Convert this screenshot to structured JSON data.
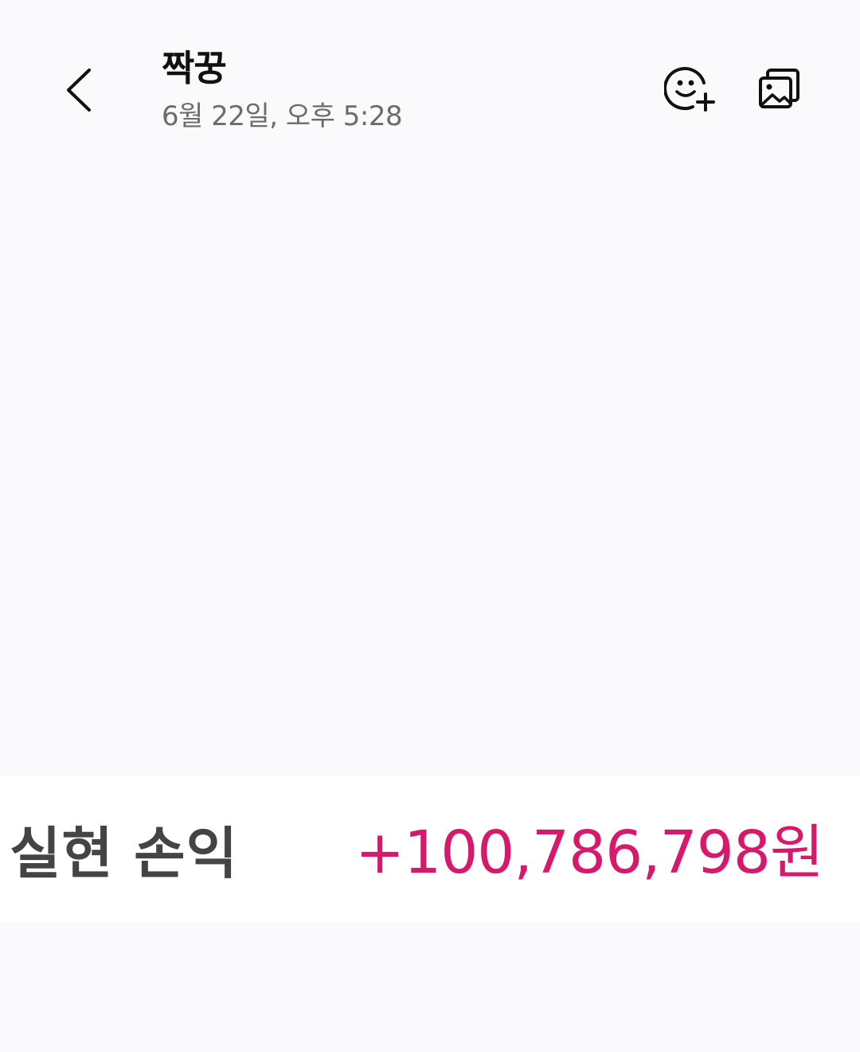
{
  "header": {
    "sender_name": "짝꿍",
    "timestamp": "6월 22일, 오후 5:28",
    "icons": {
      "back": "chevron-left-icon",
      "emoji_add": "emoji-add-icon",
      "gallery": "gallery-icon"
    }
  },
  "message": {
    "pnl_label": "실현 손익",
    "pnl_value": "+100,786,798원",
    "pnl_color": "#d6196b"
  }
}
